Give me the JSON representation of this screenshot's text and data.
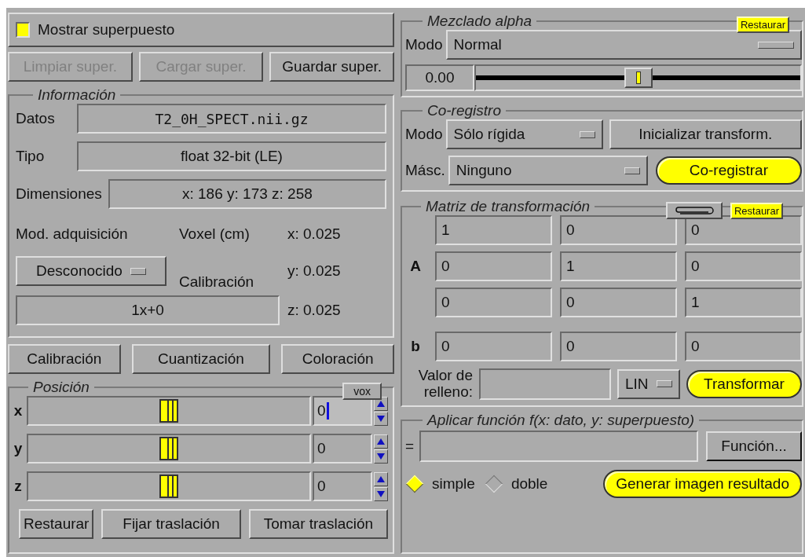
{
  "overlay": {
    "label": "Mostrar superpuesto",
    "checked": true
  },
  "overlay_buttons": [
    {
      "label": "Limpiar super.",
      "disabled": true
    },
    {
      "label": "Cargar super.",
      "disabled": true
    },
    {
      "label": "Guardar super.",
      "disabled": false
    }
  ],
  "info": {
    "title": "Información",
    "data_label": "Datos",
    "data_value": "T2_0H_SPECT.nii.gz",
    "type_label": "Tipo",
    "type_value": "float 32-bit (LE)",
    "dims_label": "Dimensiones",
    "dims_value": "x: 186  y: 173  z: 258",
    "acq_label": "Mod. adquisición",
    "acq_value": "Desconocido",
    "voxel_label": "Voxel (cm)",
    "voxel": [
      "x: 0.025",
      "y: 0.025",
      "z: 0.025"
    ],
    "calib_label": "Calibración",
    "calib_value": "1x+0"
  },
  "tool_buttons": [
    "Calibración",
    "Cuantización",
    "Coloración"
  ],
  "position": {
    "title": "Posición",
    "unit": "vox",
    "axes": [
      {
        "label": "x",
        "level": 0.5,
        "value": "0",
        "focused": true
      },
      {
        "label": "y",
        "level": 0.5,
        "value": "0",
        "focused": false
      },
      {
        "label": "z",
        "level": 0.5,
        "value": "0",
        "focused": false
      }
    ],
    "buttons": [
      "Restaurar",
      "Fijar traslación",
      "Tomar traslación"
    ]
  },
  "alpha": {
    "title": "Mezclado alpha",
    "reset": "Restaurar",
    "mode_label": "Modo",
    "mode": "Normal",
    "value": "0.00",
    "level": 0.5
  },
  "coreg": {
    "title": "Co-registro",
    "mode_label": "Modo",
    "mode": "Sólo rígida",
    "init": "Inicializar transform.",
    "mask_label": "Másc.",
    "mask": "Ninguno",
    "run": "Co-registrar"
  },
  "matrix": {
    "title": "Matriz de transformación",
    "reset": "Restaurar",
    "a_label": "A",
    "a": [
      [
        "1",
        "0",
        "0"
      ],
      [
        "0",
        "1",
        "0"
      ],
      [
        "0",
        "0",
        "1"
      ]
    ],
    "b_label": "b",
    "b": [
      "0",
      "0",
      "0"
    ],
    "fill_label": "Valor de relleno:",
    "interp": "LIN",
    "transform": "Transformar"
  },
  "function": {
    "title": "Aplicar función f(x: dato, y: superpuesto)",
    "eq": "=",
    "button": "Función...",
    "options": [
      {
        "label": "simple",
        "selected": true
      },
      {
        "label": "doble",
        "selected": false
      }
    ],
    "generate": "Generar imagen resultado"
  }
}
